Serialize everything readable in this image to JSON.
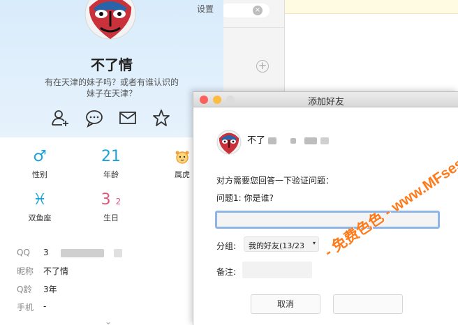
{
  "background": {
    "search_clear_glyph": "×",
    "add_glyph": "+"
  },
  "profile": {
    "settings_label": "设置",
    "nickname": "不了情",
    "signature": "有在天津的妹子吗？或者有谁认识的妹子在天津？",
    "actions": [
      "add-friend-icon",
      "chat-icon",
      "mail-icon",
      "favorite-star-icon"
    ],
    "attributes": [
      {
        "icon": "♂",
        "label": "性别",
        "color": "#1aa3d9"
      },
      {
        "icon": "21",
        "label": "年龄",
        "color": "#1aa3d9"
      },
      {
        "icon": "tiger-icon",
        "label": "属虎",
        "color": "#f2a33a"
      },
      {
        "icon": "♓",
        "label": "双鱼座",
        "color": "#1aa3d9"
      },
      {
        "icon": "3",
        "icon_suffix": "2",
        "label": "生日",
        "color": "#e0567b"
      }
    ],
    "details": [
      {
        "label": "QQ",
        "value": "3"
      },
      {
        "label": "昵称",
        "value": "不了情"
      },
      {
        "label": "Q龄",
        "value": "3年"
      },
      {
        "label": "手机",
        "value": "-"
      }
    ],
    "expand_glyph": "⌄"
  },
  "dialog": {
    "title": "添加好友",
    "peer_name": "不了",
    "question_intro": "对方需要您回答一下验证问题：",
    "question": "问题1: 你是谁?",
    "answer_value": "",
    "group_label": "分组:",
    "group_value": "我的好友(13/23",
    "remark_label": "备注:",
    "cancel_label": "取消",
    "confirm_label": "",
    "colors": {
      "close": "#fc605c",
      "minimize": "#fdbc40",
      "zoom": "#dcdcdc"
    }
  },
  "watermark": "- 免费色色 - www.MFsese.com"
}
